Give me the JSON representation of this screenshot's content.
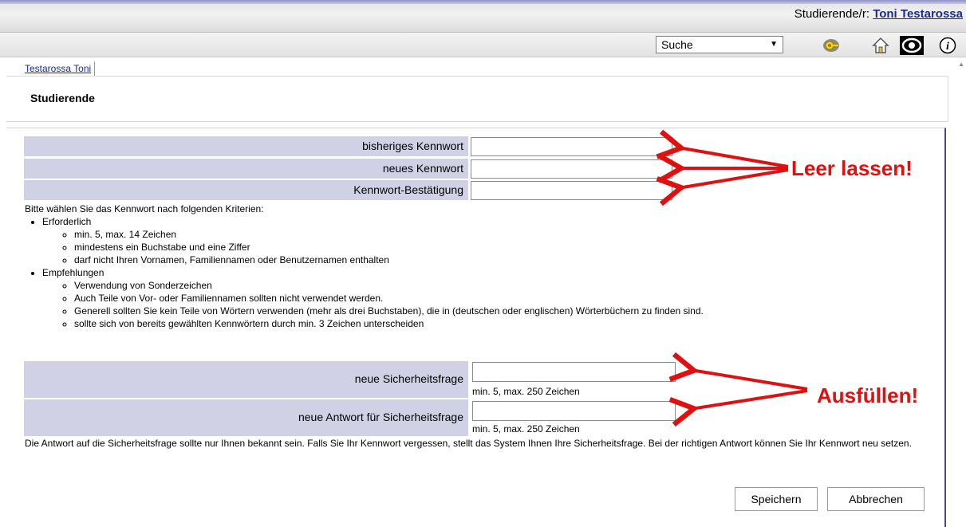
{
  "header": {
    "user_prefix": "Studierende/r:",
    "user_name": "Toni Testarossa"
  },
  "toolbar": {
    "search_select_value": "Suche",
    "icons": [
      "key-icon",
      "home-icon",
      "eye-icon",
      "info-icon"
    ]
  },
  "tab": {
    "label": "Testarossa Toni"
  },
  "page": {
    "title": "Studierende"
  },
  "password_form": {
    "old_password_label": "bisheriges Kennwort",
    "new_password_label": "neues Kennwort",
    "confirm_password_label": "Kennwort-Bestätigung",
    "old_password_value": "",
    "new_password_value": "",
    "confirm_password_value": ""
  },
  "criteria": {
    "intro": "Bitte wählen Sie das Kennwort nach folgenden Kriterien:",
    "required_title": "Erforderlich",
    "required_items": [
      "min. 5, max. 14 Zeichen",
      "mindestens ein Buchstabe und eine Ziffer",
      "darf nicht Ihren Vornamen, Familiennamen oder Benutzernamen enthalten"
    ],
    "recommended_title": "Empfehlungen",
    "recommended_items": [
      "Verwendung von Sonderzeichen",
      "Auch Teile von Vor- oder Familiennamen sollten nicht verwendet werden.",
      "Generell sollten Sie kein Teile von Wörtern verwenden (mehr als drei Buchstaben), die in (deutschen oder englischen) Wörterbüchern zu finden sind.",
      "sollte sich von bereits gewählten Kennwörtern durch min. 3 Zeichen unterscheiden"
    ]
  },
  "security_form": {
    "question_label": "neue Sicherheitsfrage",
    "answer_label": "neue Antwort für Sicherheitsfrage",
    "question_hint": "min. 5, max. 250 Zeichen",
    "answer_hint": "min. 5, max. 250 Zeichen",
    "question_value": "",
    "answer_value": ""
  },
  "security_note": "Die Antwort auf die Sicherheitsfrage sollte nur Ihnen bekannt sein. Falls Sie Ihr Kennwort vergessen, stellt das System Ihnen Ihre Sicherheitsfrage. Bei der richtigen Antwort können Sie Ihr Kennwort neu setzen.",
  "buttons": {
    "save": "Speichern",
    "cancel": "Abbrechen"
  },
  "annotations": {
    "leave_empty": "Leer lassen!",
    "fill_in": "Ausfüllen!",
    "color": "#e01010"
  },
  "colors": {
    "label_bg": "#d0d1e4",
    "link": "#1a2a9a"
  }
}
